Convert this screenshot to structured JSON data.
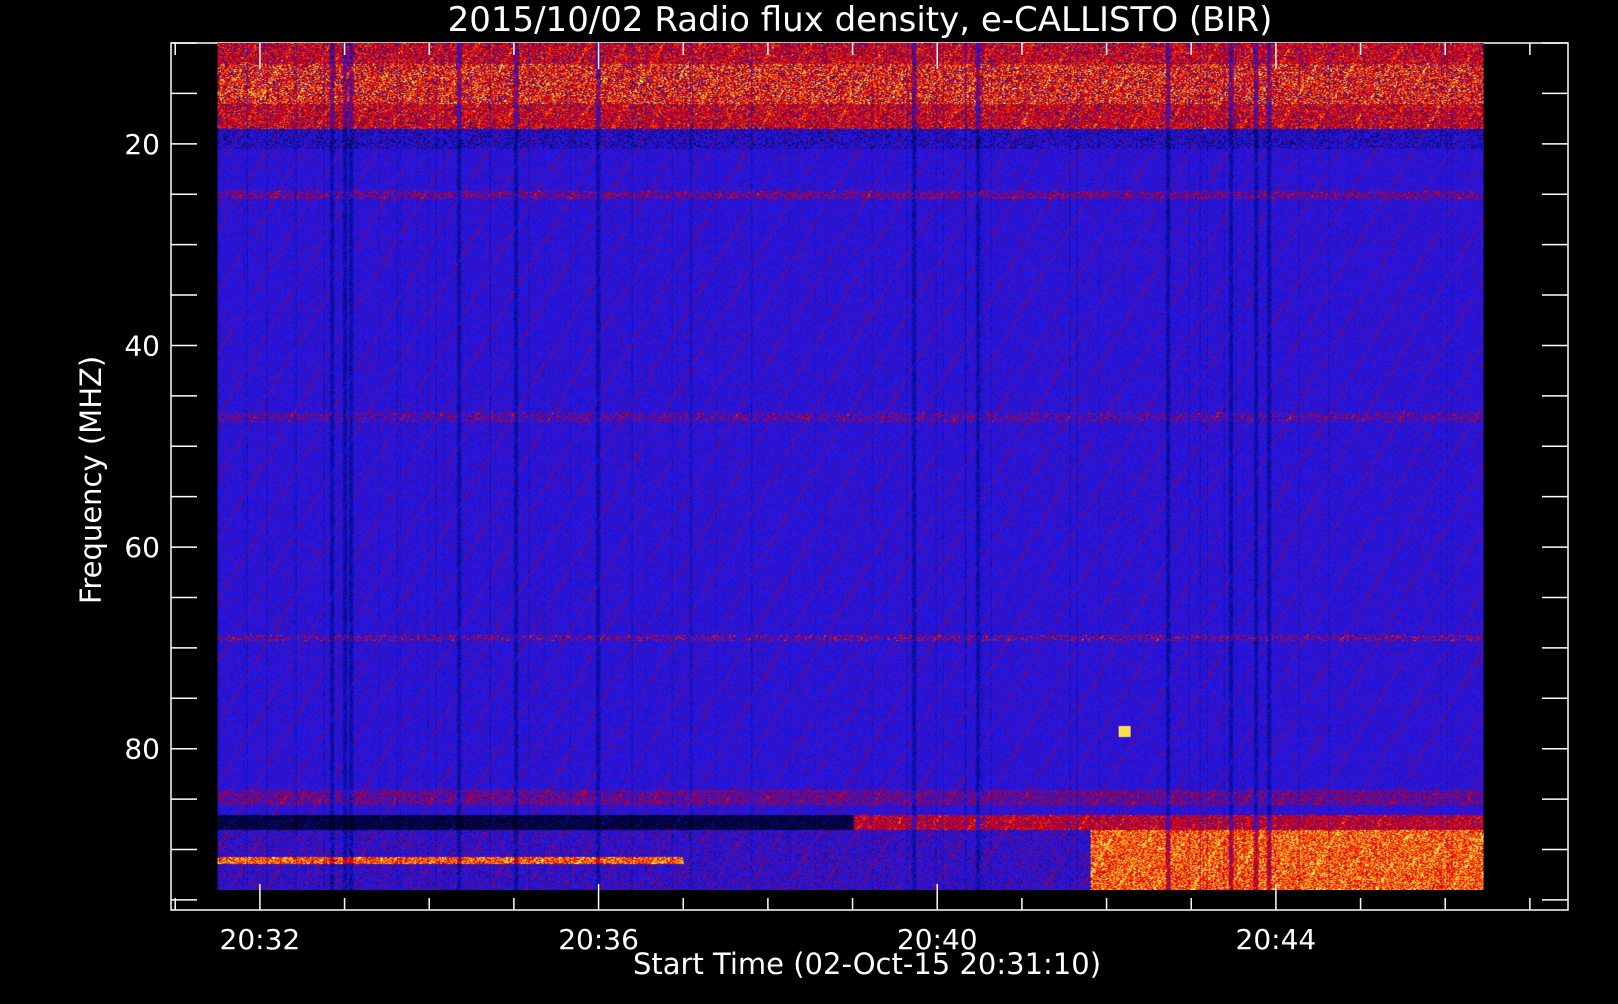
{
  "chart_data": {
    "type": "heatmap",
    "title": "2015/10/02  Radio flux density, e-CALLISTO (BIR)",
    "xlabel": "Start Time (02-Oct-15 20:31:10)",
    "ylabel": "Frequency (MHZ)",
    "x_major_ticks": [
      {
        "minutes": 32,
        "label": "20:32"
      },
      {
        "minutes": 36,
        "label": "20:36"
      },
      {
        "minutes": 40,
        "label": "20:40"
      },
      {
        "minutes": 44,
        "label": "20:44"
      }
    ],
    "x_minor_step_minutes": 1,
    "xlim_minutes": [
      30.95,
      47.45
    ],
    "data_time_range_minutes": [
      31.5,
      46.45
    ],
    "y_major_ticks": [
      {
        "value": 20,
        "label": "20"
      },
      {
        "value": 40,
        "label": "40"
      },
      {
        "value": 60,
        "label": "60"
      },
      {
        "value": 80,
        "label": "80"
      }
    ],
    "y_minor_step": 5,
    "ylim": [
      10,
      96
    ],
    "y_axis_reversed": true,
    "data_frequency_range": [
      10,
      94
    ],
    "colormap": [
      "#000000",
      "#1a1aff",
      "#cc0000",
      "#ff8800",
      "#ffff66"
    ],
    "background_color": "#1a1aff",
    "features": [
      {
        "kind": "rfi_band",
        "freq_from": 10,
        "freq_to": 18,
        "intensity": "high"
      },
      {
        "kind": "rfi_band",
        "freq_from": 85,
        "freq_to": 94,
        "intensity": "high",
        "time_from": 41.8,
        "time_to": 46.45
      },
      {
        "kind": "spot",
        "time": 42.2,
        "freq": 78.2,
        "intensity": "very_high"
      }
    ]
  }
}
